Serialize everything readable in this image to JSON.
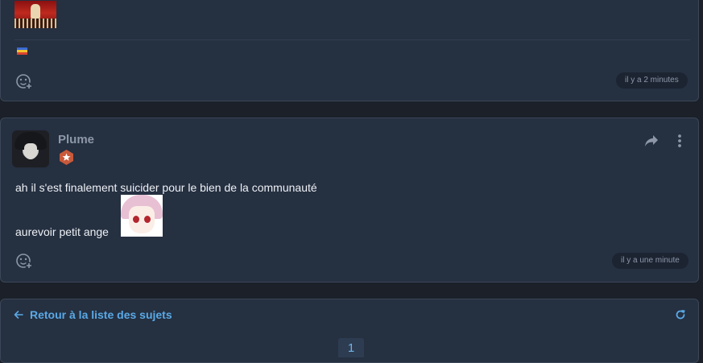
{
  "previous_post": {
    "timestamp": "il y a 2 minutes"
  },
  "post": {
    "author": "Plume",
    "lines": [
      "ah il s'est finalement suicider pour le bien de la communauté",
      "aurevoir petit ange"
    ],
    "timestamp": "il y a une minute"
  },
  "footer": {
    "back_label": "Retour à la liste des sujets",
    "current_page": "1"
  },
  "icons": {
    "react": "add-reaction-icon",
    "share": "share-icon",
    "more": "more-vertical-icon",
    "back": "arrow-left-icon",
    "refresh": "refresh-icon",
    "rank": "star-badge-icon"
  },
  "colors": {
    "background": "#1b2029",
    "card": "#253041",
    "accent": "#5aa9e6",
    "rank_badge": "#c8593a",
    "text": "#eef1f5",
    "muted": "#8d97a8"
  }
}
